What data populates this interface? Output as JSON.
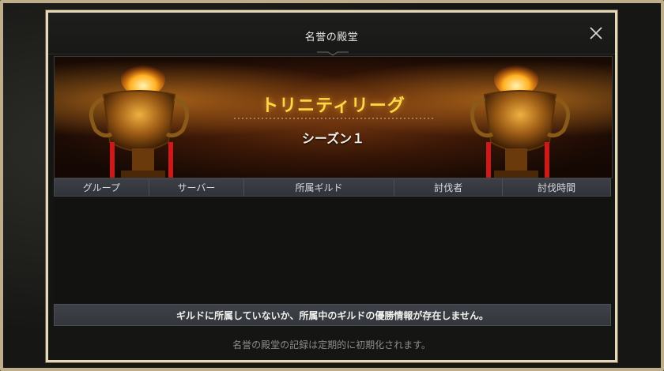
{
  "dialog": {
    "title": "名誉の殿堂",
    "close_icon": "close-icon"
  },
  "banner": {
    "title": "トリニティリーグ",
    "subtitle": "シーズン１",
    "title_color": "#ffd84a",
    "decor_icon": "trophy-icon"
  },
  "table": {
    "columns": [
      "グループ",
      "サーバー",
      "所属ギルド",
      "討伐者",
      "討伐時間"
    ],
    "rows": []
  },
  "notice": "ギルドに所属していないか、所属中のギルドの優勝情報が存在しません。",
  "footer_note": "名誉の殿堂の記録は定期的に初期化されます。"
}
